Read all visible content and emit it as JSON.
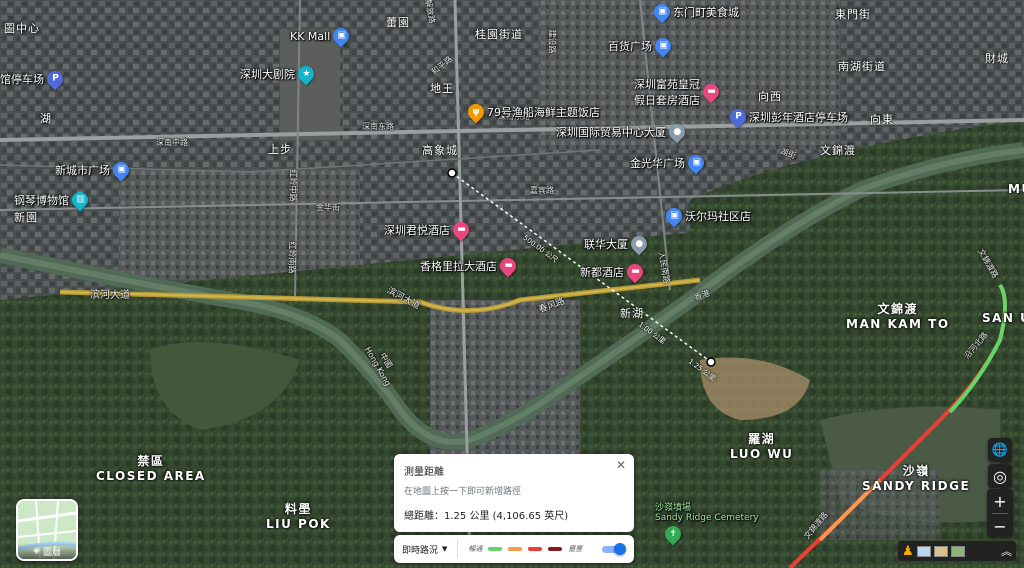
{
  "poi": [
    {
      "label": "KK Mall",
      "color": "#4285f4",
      "glyph": "▣",
      "icon": "shopping-icon"
    },
    {
      "label": "东门町美食城",
      "color": "#4285f4",
      "glyph": "▣",
      "icon": "shopping-icon"
    },
    {
      "label": "百货广场",
      "color": "#4285f4",
      "glyph": "▣",
      "icon": "shopping-icon"
    },
    {
      "label": "深圳大剧院",
      "color": "#12b5cb",
      "glyph": "★",
      "icon": "theater-icon"
    },
    {
      "label": "馆停车场",
      "color": "#4f6ad6",
      "glyph": "P",
      "icon": "parking-icon"
    },
    {
      "label": "79号渔船海鲜主题饭店",
      "color": "#f29900",
      "glyph": "ψ",
      "icon": "restaurant-icon"
    },
    {
      "label": "深圳富苑皇冠\n假日套房酒店",
      "color": "#e8467c",
      "glyph": "▬",
      "icon": "hotel-icon"
    },
    {
      "label": "深圳彭年酒店停车场",
      "color": "#4f6ad6",
      "glyph": "P",
      "icon": "parking-icon"
    },
    {
      "label": "深圳国际贸易中心大厦",
      "color": "#8a9aa8",
      "glyph": "●",
      "icon": "landmark-icon"
    },
    {
      "label": "新城市广场",
      "color": "#4285f4",
      "glyph": "▣",
      "icon": "shopping-icon"
    },
    {
      "label": "金光华广场",
      "color": "#4285f4",
      "glyph": "▣",
      "icon": "shopping-icon"
    },
    {
      "label": "钢琴博物馆",
      "color": "#12b5cb",
      "glyph": "▥",
      "icon": "museum-icon"
    },
    {
      "label": "沃尔玛社区店",
      "color": "#4285f4",
      "glyph": "▣",
      "icon": "shopping-icon"
    },
    {
      "label": "深圳君悦酒店",
      "color": "#e8467c",
      "glyph": "▬",
      "icon": "hotel-icon"
    },
    {
      "label": "联华大厦",
      "color": "#8a9aa8",
      "glyph": "●",
      "icon": "landmark-icon"
    },
    {
      "label": "香格里拉大酒店",
      "color": "#e8467c",
      "glyph": "▬",
      "icon": "hotel-icon"
    },
    {
      "label": "新都酒店",
      "color": "#e8467c",
      "glyph": "▬",
      "icon": "hotel-icon"
    },
    {
      "label": "沙嶺墳場\nSandy Ridge Cemetery",
      "color": "#34a853",
      "glyph": "✝",
      "icon": "cemetery-icon"
    }
  ],
  "areas": [
    "圖中心",
    "地王",
    "上步",
    "高象城",
    "向西",
    "向東",
    "南湖街道",
    "東門街",
    "文錦渡",
    "新湖",
    "文錦渡\nMAN KAM TO",
    "羅湖\nLUO WU",
    "禁區\nCLOSED AREA",
    "料壆\nLIU POK",
    "沙嶺\nSANDY RIDGE",
    "SAN U",
    "MU",
    "財城",
    "桂園街道",
    "蕾園",
    "新園",
    "湖"
  ],
  "roads": [
    "滨河大道",
    "滨河大道",
    "深南中路",
    "深南东路",
    "深南东路",
    "金华街",
    "嘉宾路",
    "人民南路",
    "红岭南路",
    "红岭中路",
    "建设路",
    "和平路",
    "春风路",
    "中國",
    "Hong Kong",
    "文錦渡路",
    "文錦渡路",
    "香港",
    "解放路",
    "沿河北路",
    "湖街"
  ],
  "measurement": {
    "segment_labels": [
      "500.00 公尺",
      "1.00 公里",
      "1.25 公里"
    ],
    "card_title": "測量距離",
    "card_hint": "在地圖上按一下即可新增路徑",
    "card_total": "總距離：1.25 公里 (4,106.65 英尺)",
    "close_glyph": "✕"
  },
  "traffic": {
    "dropdown_label": "即時路況",
    "fast_label": "暢通",
    "slow_label": "壅塞",
    "colors": [
      "#63d668",
      "#ff974d",
      "#f23c32",
      "#811f1f"
    ],
    "toggle_on": true
  },
  "layers": {
    "label": "圖層"
  },
  "controls": {
    "globe_icon": "🌐",
    "locate_icon": "◎",
    "zoom_in": "+",
    "zoom_out": "−",
    "expand_icon": "︽"
  }
}
